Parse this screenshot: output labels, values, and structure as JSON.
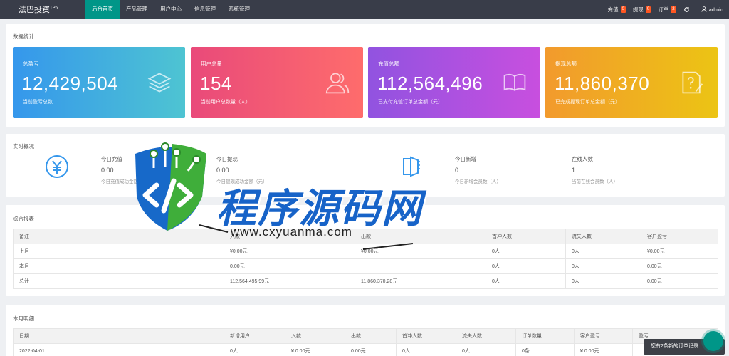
{
  "app": {
    "logo": "法巴投资",
    "logo_sup": "TP6"
  },
  "nav": [
    {
      "label": "后台首页",
      "active": true
    },
    {
      "label": "产品管理"
    },
    {
      "label": "用户中心"
    },
    {
      "label": "信息管理"
    },
    {
      "label": "系统管理"
    }
  ],
  "right_nav": {
    "recharge": {
      "label": "充值",
      "badge": "0"
    },
    "withdraw": {
      "label": "提现",
      "badge": "0"
    },
    "orders": {
      "label": "订单",
      "badge": "2"
    },
    "user": "admin"
  },
  "stats_panel": {
    "title": "数据统计",
    "cards": [
      {
        "label": "总盈亏",
        "value": "12,429,504",
        "desc": "当前盈亏总数",
        "icon": "stack-icon"
      },
      {
        "label": "用户总量",
        "value": "154",
        "desc": "当前用户总数量（人）",
        "icon": "users-icon"
      },
      {
        "label": "充值总额",
        "value": "112,564,496",
        "desc": "已支付充值订单总金额（元）",
        "icon": "book-icon"
      },
      {
        "label": "提现总额",
        "value": "11,860,370",
        "desc": "已完成提现订单总金额（元）",
        "icon": "edit-doc-icon"
      }
    ]
  },
  "realtime": {
    "title": "实时概况",
    "items": [
      {
        "title": "今日充值",
        "value": "0.00",
        "desc": "今日充值成功金额（元）"
      },
      {
        "title": "今日提现",
        "value": "0.00",
        "desc": "今日提现成功金额（元）"
      },
      {
        "title": "今日新增",
        "value": "0",
        "desc": "今日新增会员数（人）"
      },
      {
        "title": "在线人数",
        "value": "1",
        "desc": "当前在线会员数（人）"
      }
    ]
  },
  "summary": {
    "title": "综合报表",
    "headers": [
      "备注",
      "入款",
      "出款",
      "首冲人数",
      "流失人数",
      "客户盈亏"
    ],
    "rows": [
      [
        "上月",
        "¥0.00元",
        "¥0.00元",
        "0人",
        "0人",
        "¥0.00元"
      ],
      [
        "本月",
        "0.00元",
        "",
        "0人",
        "0人",
        "0.00元"
      ],
      [
        "总计",
        "112,564,495.99元",
        "11,860,370.28元",
        "0人",
        "0人",
        "0.00元"
      ]
    ]
  },
  "monthly": {
    "title": "本月明细",
    "headers": [
      "日期",
      "新增用户",
      "入款",
      "出款",
      "首冲人数",
      "流失人数",
      "订单数量",
      "客户盈亏",
      "盈亏"
    ],
    "rows": [
      [
        "2022-04-01",
        "0人",
        "¥ 0.00元",
        "0.00元",
        "0人",
        "0人",
        "0条",
        "¥ 0.00元",
        ""
      ]
    ]
  },
  "watermark": {
    "brand": "程序源码网",
    "url": "www.cxyuanma.com"
  },
  "toast": "您有2条新的订单记录",
  "colors": {
    "topbar": "#393d49",
    "accent": "#009688",
    "badge": "#ff5722"
  }
}
